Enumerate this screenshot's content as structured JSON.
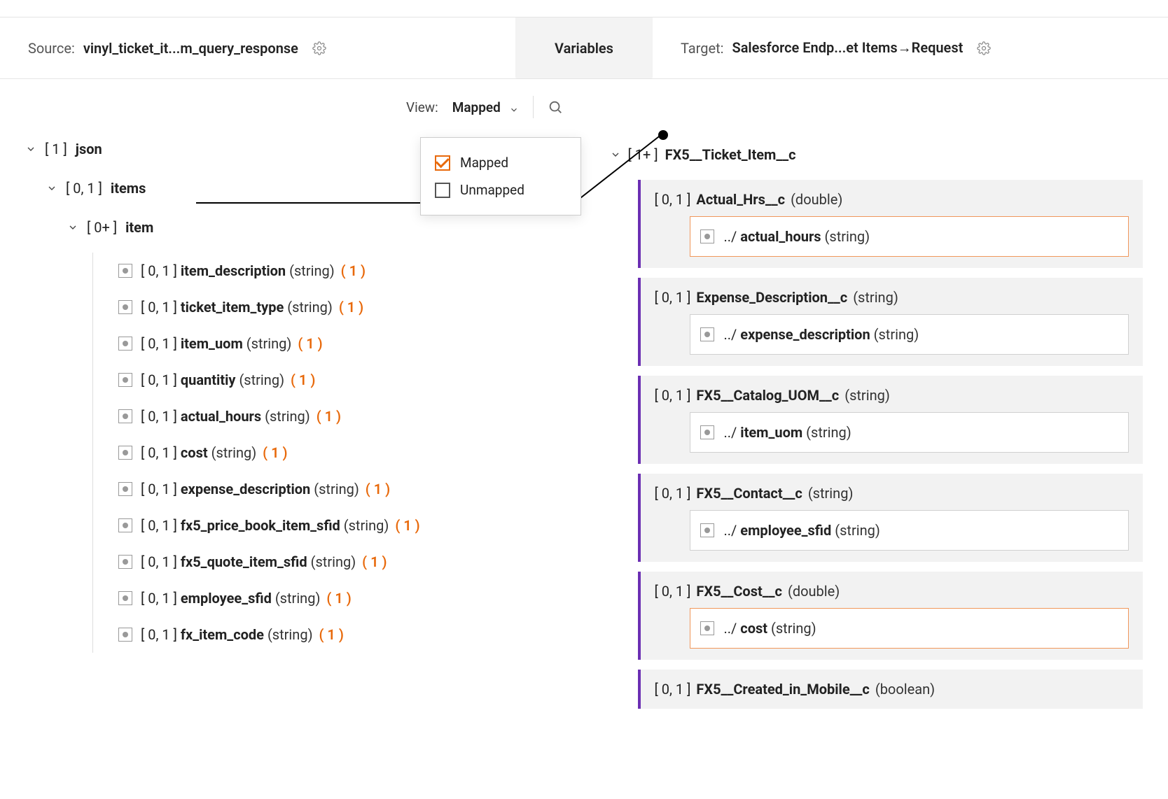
{
  "header": {
    "source_label": "Source:",
    "source_name": "vinyl_ticket_it...m_query_response",
    "target_label": "Target:",
    "target_name": "Salesforce Endp...et Items→Request",
    "variables_tab": "Variables"
  },
  "toolbar": {
    "view_label": "View:",
    "view_value": "Mapped"
  },
  "dropdown": {
    "mapped": "Mapped",
    "unmapped": "Unmapped"
  },
  "source_tree": {
    "root_card": "[ 1 ]",
    "root_name": "json",
    "items_card": "[ 0, 1 ]",
    "items_name": "items",
    "item_card": "[ 0+ ]",
    "item_name": "item",
    "leaves": [
      {
        "card": "[ 0, 1 ]",
        "name": "item_description",
        "type": "(string)",
        "count": "( 1 )"
      },
      {
        "card": "[ 0, 1 ]",
        "name": "ticket_item_type",
        "type": "(string)",
        "count": "( 1 )"
      },
      {
        "card": "[ 0, 1 ]",
        "name": "item_uom",
        "type": "(string)",
        "count": "( 1 )"
      },
      {
        "card": "[ 0, 1 ]",
        "name": "quantitiy",
        "type": "(string)",
        "count": "( 1 )"
      },
      {
        "card": "[ 0, 1 ]",
        "name": "actual_hours",
        "type": "(string)",
        "count": "( 1 )"
      },
      {
        "card": "[ 0, 1 ]",
        "name": "cost",
        "type": "(string)",
        "count": "( 1 )"
      },
      {
        "card": "[ 0, 1 ]",
        "name": "expense_description",
        "type": "(string)",
        "count": "( 1 )"
      },
      {
        "card": "[ 0, 1 ]",
        "name": "fx5_price_book_item_sfid",
        "type": "(string)",
        "count": "( 1 )"
      },
      {
        "card": "[ 0, 1 ]",
        "name": "fx5_quote_item_sfid",
        "type": "(string)",
        "count": "( 1 )"
      },
      {
        "card": "[ 0, 1 ]",
        "name": "employee_sfid",
        "type": "(string)",
        "count": "( 1 )"
      },
      {
        "card": "[ 0, 1 ]",
        "name": "fx_item_code",
        "type": "(string)",
        "count": "( 1 )"
      }
    ]
  },
  "target_tree": {
    "root_card": "[ 1+ ]",
    "root_name": "FX5__Ticket_Item__c",
    "items": [
      {
        "card": "[ 0, 1 ]",
        "name": "Actual_Hrs__c",
        "type": "(double)",
        "mapped_path": "../",
        "mapped_name": "actual_hours",
        "mapped_type": "(string)",
        "highlighted": true
      },
      {
        "card": "[ 0, 1 ]",
        "name": "Expense_Description__c",
        "type": "(string)",
        "mapped_path": "../",
        "mapped_name": "expense_description",
        "mapped_type": "(string)",
        "highlighted": false
      },
      {
        "card": "[ 0, 1 ]",
        "name": "FX5__Catalog_UOM__c",
        "type": "(string)",
        "mapped_path": "../",
        "mapped_name": "item_uom",
        "mapped_type": "(string)",
        "highlighted": false
      },
      {
        "card": "[ 0, 1 ]",
        "name": "FX5__Contact__c",
        "type": "(string)",
        "mapped_path": "../",
        "mapped_name": "employee_sfid",
        "mapped_type": "(string)",
        "highlighted": false
      },
      {
        "card": "[ 0, 1 ]",
        "name": "FX5__Cost__c",
        "type": "(double)",
        "mapped_path": "../",
        "mapped_name": "cost",
        "mapped_type": "(string)",
        "highlighted": true
      },
      {
        "card": "[ 0, 1 ]",
        "name": "FX5__Created_in_Mobile__c",
        "type": "(boolean)",
        "highlighted": false,
        "no_map": true
      }
    ]
  }
}
